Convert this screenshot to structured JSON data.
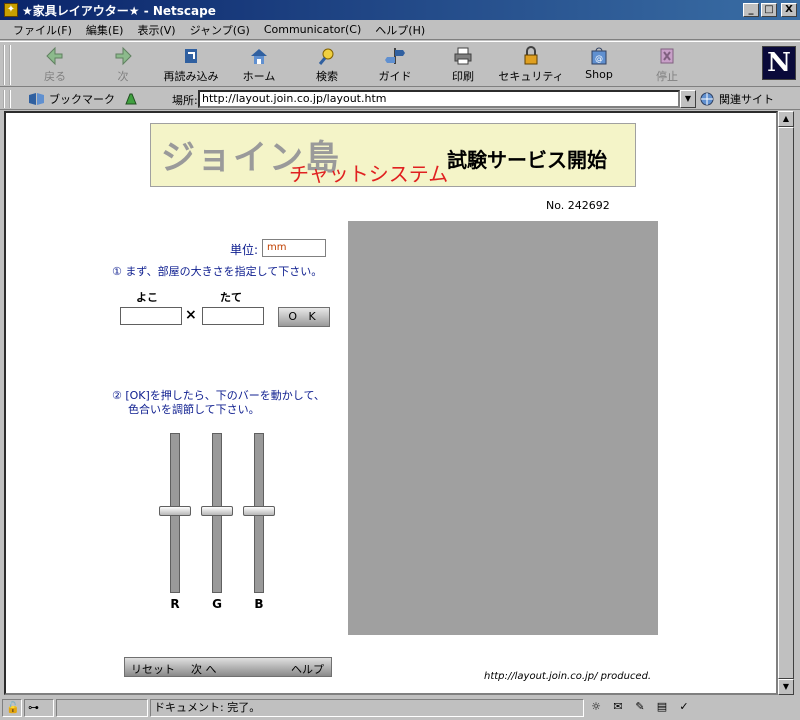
{
  "window": {
    "title": "★家具レイアウター★ - Netscape",
    "controls": [
      "_",
      "□",
      "X"
    ]
  },
  "menu": [
    "ファイル(F)",
    "編集(E)",
    "表示(V)",
    "ジャンプ(G)",
    "Communicator(C)",
    "ヘルプ(H)"
  ],
  "toolbar": {
    "buttons": [
      {
        "label": "戻る",
        "icon": "back-arrow-icon",
        "enabled": false
      },
      {
        "label": "次",
        "icon": "forward-arrow-icon",
        "enabled": false
      },
      {
        "label": "再読み込み",
        "icon": "reload-icon",
        "enabled": true
      },
      {
        "label": "ホーム",
        "icon": "home-icon",
        "enabled": true
      },
      {
        "label": "検索",
        "icon": "search-icon",
        "enabled": true
      },
      {
        "label": "ガイド",
        "icon": "guide-icon",
        "enabled": true
      },
      {
        "label": "印刷",
        "icon": "print-icon",
        "enabled": true
      },
      {
        "label": "セキュリティ",
        "icon": "lock-icon",
        "enabled": true
      },
      {
        "label": "Shop",
        "icon": "shop-icon",
        "enabled": true
      },
      {
        "label": "停止",
        "icon": "stop-icon",
        "enabled": false
      }
    ],
    "logo_letter": "N"
  },
  "location": {
    "bookmark_label": "ブックマーク",
    "label": "場所:",
    "url": "http://layout.join.co.jp/layout.htm",
    "related_label": "関連サイト"
  },
  "page": {
    "banner": {
      "title": "ジョイン島",
      "subtitle": "チャットシステム",
      "tagline": "試験サービス開始"
    },
    "counter": "No. 242692",
    "unit": {
      "label": "単位:",
      "value": "mm"
    },
    "step1": "① まず、部屋の大きさを指定して下さい。",
    "width_label": "よこ",
    "height_label": "たて",
    "times_symbol": "×",
    "ok_label": "O K",
    "step2_line1": "② [OK]を押したら、下のバーを動かして、",
    "step2_line2": "色合いを調節して下さい。",
    "sliders": [
      {
        "label": "R",
        "level": 0.5
      },
      {
        "label": "G",
        "level": 0.5
      },
      {
        "label": "B",
        "level": 0.5
      }
    ],
    "bottom_buttons": {
      "reset": "リセット",
      "next": "次 へ",
      "help": "ヘルプ"
    },
    "credit": "http://layout.join.co.jp/  produced."
  },
  "status": {
    "text": "ドキュメント: 完了。"
  },
  "colors": {
    "canvas": "#a0a0a0",
    "banner_bg": "#f4f4c8",
    "accent_red": "#e02020",
    "link_blue": "#102090"
  }
}
